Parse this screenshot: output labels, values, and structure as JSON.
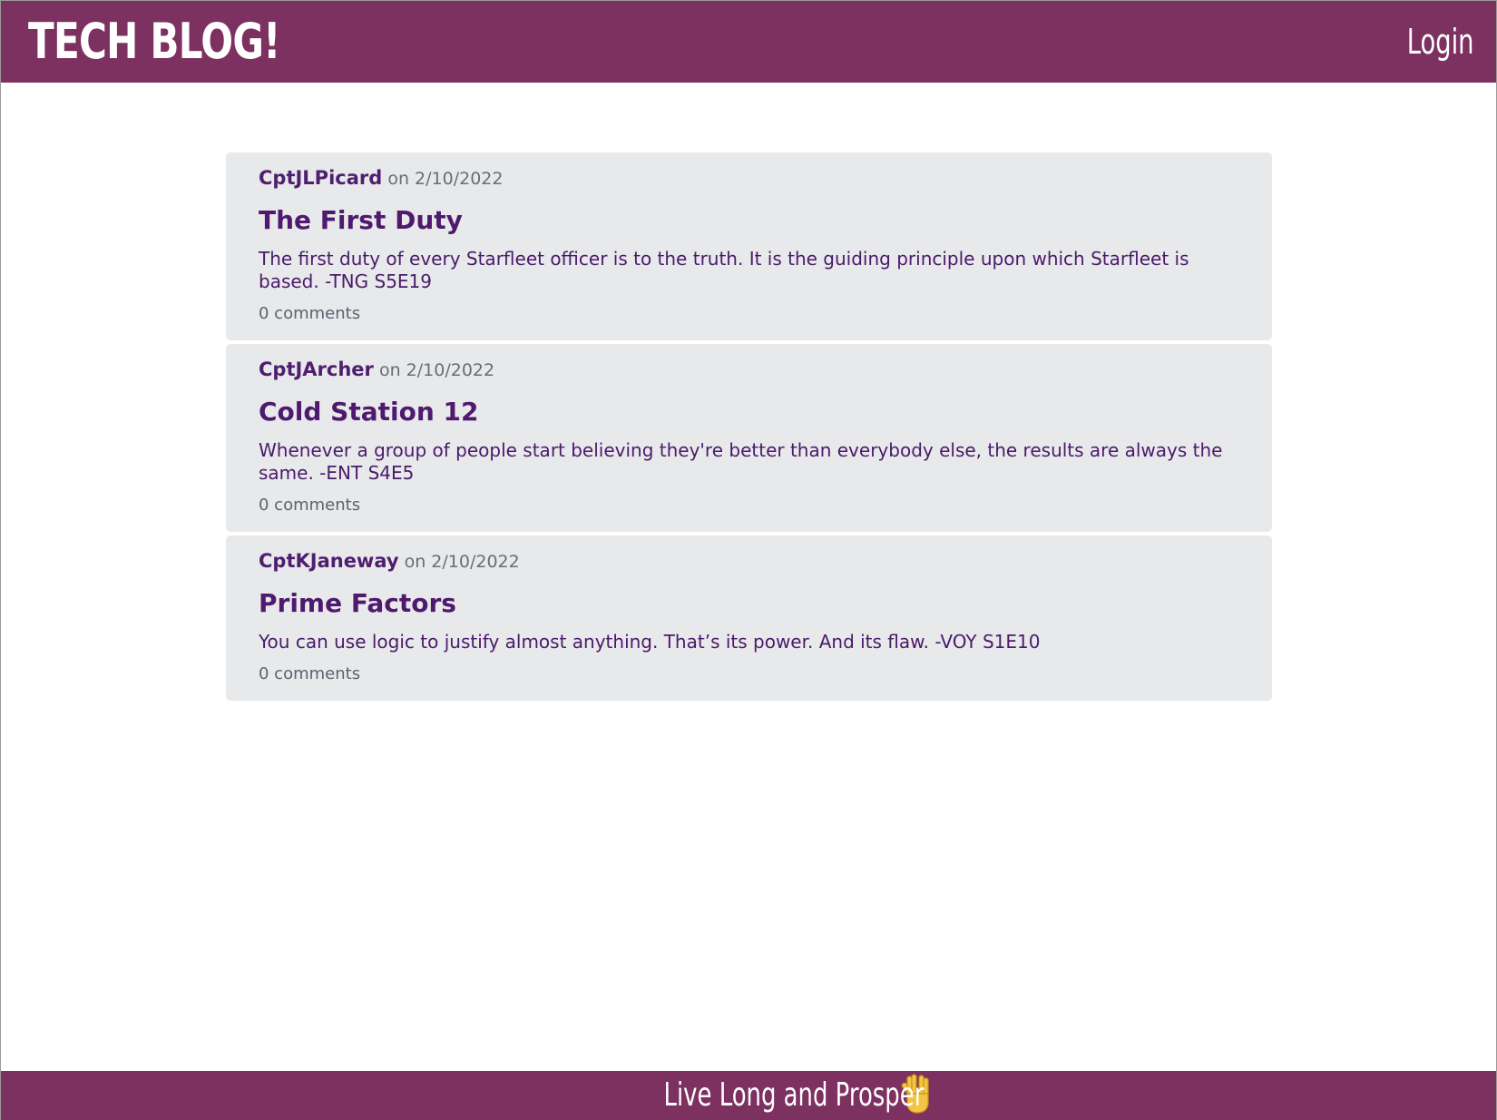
{
  "header": {
    "brand": "TECH BLOG!",
    "login_label": "Login"
  },
  "posts": [
    {
      "author": "CptJLPicard",
      "date_text": "on 2/10/2022",
      "title": "The First Duty",
      "content": "The first duty of every Starfleet officer is to the truth. It is the guiding principle upon which Starfleet is based. -TNG S5E19",
      "comments": "0 comments"
    },
    {
      "author": "CptJArcher",
      "date_text": "on 2/10/2022",
      "title": "Cold Station 12",
      "content": "Whenever a group of people start believing they're better than everybody else, the results are always the same. -ENT S4E5",
      "comments": "0 comments"
    },
    {
      "author": "CptKJaneway",
      "date_text": "on 2/10/2022",
      "title": "Prime Factors",
      "content": "You can use logic to justify almost anything. That’s its power. And its flaw. -VOY S1E10",
      "comments": "0 comments"
    }
  ],
  "footer": {
    "text": "Live Long and Prosper",
    "icon": "vulcan-salute-icon"
  },
  "colors": {
    "brand_bar": "#7d3160",
    "card_background": "#e8e9eb",
    "title_text": "#4f1a6e",
    "meta_text": "#6c6c78"
  }
}
